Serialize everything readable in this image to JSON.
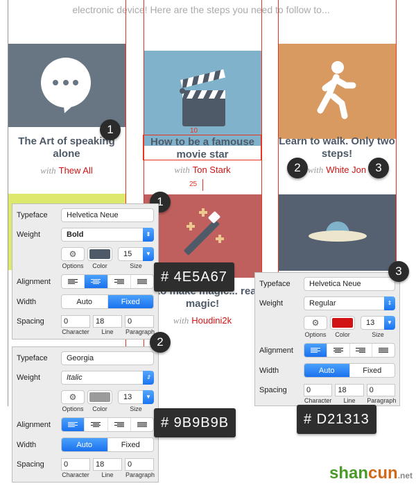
{
  "intro_text": "electronic device! Here are the steps you need to follow to...",
  "cards": [
    {
      "title": "The Art of speaking alone",
      "with": "with",
      "author": "Thew All",
      "color": "#687684",
      "icon": "speech-bubble-icon"
    },
    {
      "title": "How to be a famouse movie star",
      "with": "with",
      "author": "Ton Stark",
      "color": "#80b3cb",
      "icon": "clapperboard-icon"
    },
    {
      "title": "Learn to walk. Only two steps!",
      "with": "with",
      "author": "White Jon",
      "color": "#d99a62",
      "icon": "walking-person-icon"
    },
    {
      "title": "w to make magic... real magic!",
      "with": "with",
      "author": "Houdini2k",
      "color": "#c0605e",
      "icon": "magic-wand-icon"
    },
    {
      "color": "#dde96c"
    },
    {
      "color": "#556170",
      "icon": "ufo-icon"
    }
  ],
  "measurements": {
    "top": "10",
    "bottom": "25"
  },
  "badges": [
    "1",
    "1",
    "2",
    "2",
    "3",
    "3"
  ],
  "tooltips": [
    "# 4E5A67",
    "# 9B9B9B",
    "# D21313"
  ],
  "labels": {
    "typeface": "Typeface",
    "weight": "Weight",
    "options": "Options",
    "color": "Color",
    "size": "Size",
    "alignment": "Alignment",
    "width": "Width",
    "spacing": "Spacing",
    "character": "Character",
    "line": "Line",
    "paragraph": "Paragraph",
    "auto": "Auto",
    "fixed": "Fixed"
  },
  "panels": [
    {
      "typeface": "Helvetica Neue",
      "weight": "Bold",
      "size": "15",
      "color": "#4E5A67",
      "alignment": "center",
      "width": "Fixed",
      "character": "0",
      "line": "18",
      "paragraph": "0"
    },
    {
      "typeface": "Georgia",
      "weight": "Italic",
      "size": "13",
      "color": "#9B9B9B",
      "alignment": "left",
      "width": "Auto",
      "character": "0",
      "line": "18",
      "paragraph": "0"
    },
    {
      "typeface": "Helvetica Neue",
      "weight": "Regular",
      "size": "13",
      "color": "#D21313",
      "alignment": "left",
      "width": "Auto",
      "character": "0",
      "line": "18",
      "paragraph": "0"
    }
  ],
  "watermark": "shancun.net"
}
